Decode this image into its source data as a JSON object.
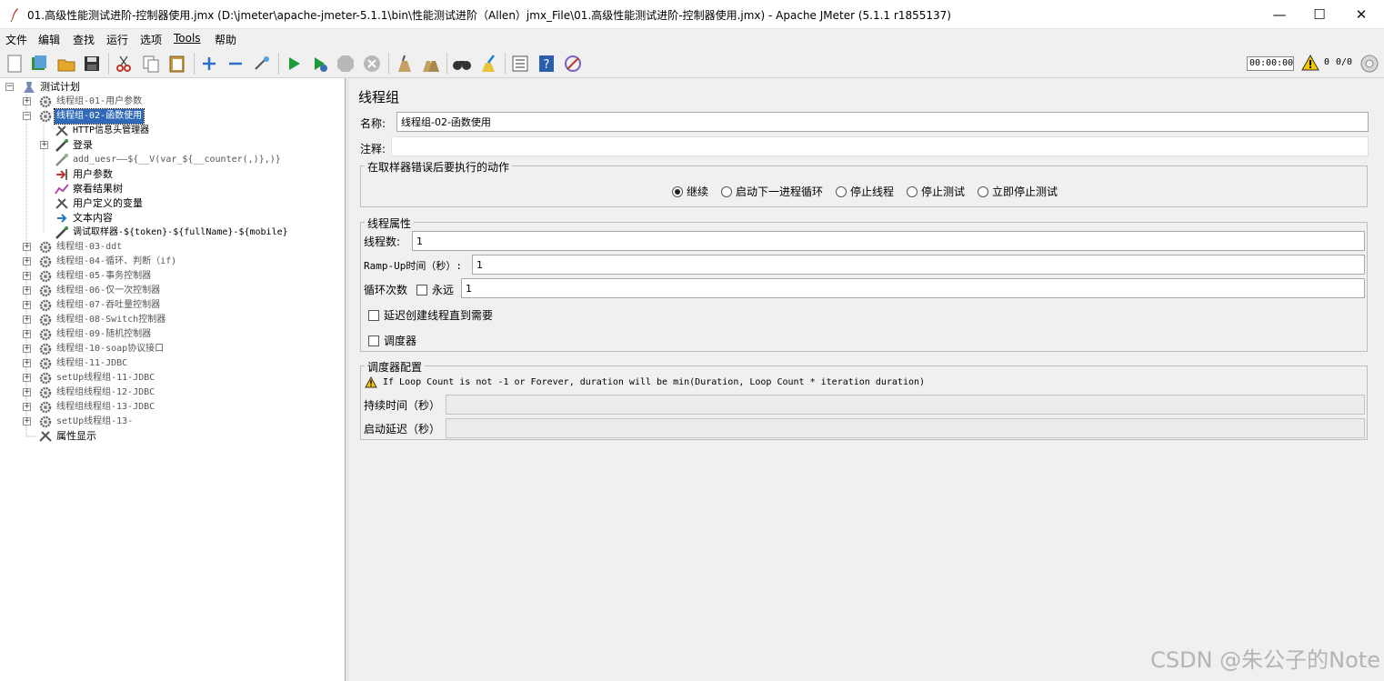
{
  "window": {
    "title": "01.高级性能测试进阶-控制器使用.jmx (D:\\jmeter\\apache-jmeter-5.1.1\\bin\\性能测试进阶（Allen）jmx_File\\01.高级性能测试进阶-控制器使用.jmx) - Apache JMeter (5.1.1 r1855137)",
    "min": "—",
    "max": "☐",
    "close": "✕"
  },
  "menu": [
    "文件",
    "编辑",
    "查找",
    "运行",
    "选项",
    "Tools",
    "帮助"
  ],
  "toolbar": {
    "timer": "00:00:00",
    "counter_left": "0",
    "counter_right": "0/0"
  },
  "tree": {
    "root": "测试计划",
    "groups": [
      "线程组-01-用户参数",
      "线程组-02-函数使用",
      "线程组-03-ddt",
      "线程组-04-循环、判断（if)",
      "线程组-05-事务控制器",
      "线程组-06-仅一次控制器",
      "线程组-07-吞吐量控制器",
      "线程组-08-Switch控制器",
      "线程组-09-随机控制器",
      "线程组-10-soap协议接口",
      "线程组-11-JDBC",
      "setUp线程组-11-JDBC",
      "线程组线程组-12-JDBC",
      "线程组线程组-13-JDBC",
      "setUp线程组-13-"
    ],
    "children": [
      "HTTP信息头管理器",
      "登录",
      "add_uesr——${__V(var_${__counter(,)},)}",
      "用户参数",
      "察看结果树",
      "用户定义的变量",
      "文本内容",
      "调试取样器-${token}-${fullName}-${mobile}"
    ],
    "footer": "属性显示"
  },
  "panel": {
    "title": "线程组",
    "name_label": "名称:",
    "name_value": "线程组-02-函数使用",
    "comment_label": "注释:",
    "error_group_title": "在取样器错误后要执行的动作",
    "error_actions": [
      "继续",
      "启动下一进程循环",
      "停止线程",
      "停止测试",
      "立即停止测试"
    ],
    "thread_group_title": "线程属性",
    "threads_label": "线程数:",
    "threads_value": "1",
    "rampup_label": "Ramp-Up时间（秒）:",
    "rampup_value": "1",
    "loop_label": "循环次数",
    "forever_label": "永远",
    "loop_value": "1",
    "delay_label": "延迟创建线程直到需要",
    "scheduler_label": "调度器",
    "scheduler_group_title": "调度器配置",
    "scheduler_warning": "If Loop Count is not -1 or Forever, duration will be min(Duration, Loop Count * iteration duration)",
    "duration_label": "持续时间（秒）",
    "startup_delay_label": "启动延迟（秒）"
  },
  "watermark": "CSDN @朱公子的Note"
}
